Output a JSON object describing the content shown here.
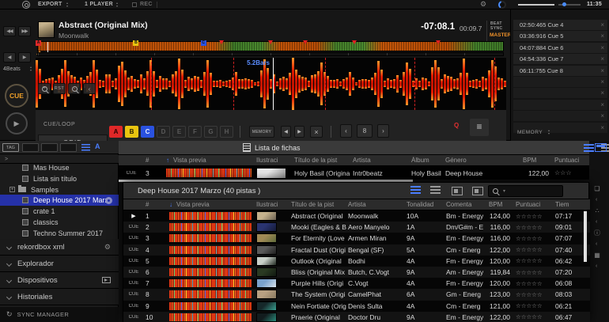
{
  "top_bar": {
    "mode": "EXPORT",
    "player": "1 PLAYER",
    "rec_label": "REC",
    "clock": "11:35",
    "accent_color": "#4a8dff"
  },
  "deck": {
    "track_title": "Abstract (Original Mix)",
    "track_artist": "Moonwalk",
    "time_remaining": "-07:08.1",
    "time_elapsed": "00:09.7",
    "beat_sync_line1": "BEAT",
    "beat_sync_line2": "SYNC",
    "master_label": "MASTER",
    "master_color": "#f0922a",
    "bars_label": "5.2Bars",
    "beat_jump_label": "4Beats",
    "cue_button_label": "CUE",
    "cue_loop_label": "CUE/LOOP",
    "grid_label": "GRID",
    "rst_label": "RST",
    "memory_label": "MEMORY",
    "memory_bank_value": "8",
    "quantize_label": "Q",
    "hot_cues": [
      {
        "label": "A",
        "bg": "#e02828",
        "fg": "#2a0000",
        "set": true
      },
      {
        "label": "B",
        "bg": "#e8c410",
        "fg": "#2a2000",
        "set": true
      },
      {
        "label": "C",
        "bg": "#2a52e0",
        "fg": "#e8eeff",
        "set": true
      },
      {
        "label": "D",
        "bg": "#242424",
        "fg": "#5a5a5a",
        "set": false
      },
      {
        "label": "E",
        "bg": "#242424",
        "fg": "#5a5a5a",
        "set": false
      },
      {
        "label": "F",
        "bg": "#242424",
        "fg": "#5a5a5a",
        "set": false
      },
      {
        "label": "G",
        "bg": "#242424",
        "fg": "#5a5a5a",
        "set": false
      },
      {
        "label": "H",
        "bg": "#242424",
        "fg": "#5a5a5a",
        "set": false
      }
    ],
    "overview_markers": [
      {
        "label": "A",
        "color": "#e02828",
        "pos": 0
      },
      {
        "label": "B",
        "color": "#e8c410",
        "pos": 21
      },
      {
        "label": "C",
        "color": "#2a52e0",
        "pos": 35.5
      },
      {
        "pos": 39.5
      },
      {
        "pos": 50
      },
      {
        "pos": 57.5
      },
      {
        "pos": 68
      },
      {
        "pos": 86
      }
    ],
    "cue_line_positions": [
      24.5,
      42,
      61.5,
      80.5,
      97.5
    ],
    "waveform_color": "#e01800"
  },
  "cue_list": {
    "items": [
      {
        "time": "02:50:465",
        "name": "Cue 4"
      },
      {
        "time": "03:36:916",
        "name": "Cue 5"
      },
      {
        "time": "04:07:884",
        "name": "Cue 6"
      },
      {
        "time": "04:54:336",
        "name": "Cue 7"
      },
      {
        "time": "06:11:755",
        "name": "Cue 8"
      }
    ],
    "empty_rows": 5,
    "memory_label": "MEMORY"
  },
  "sidebar": {
    "tag_label": "TAG",
    "collapse_caret": ">",
    "tree": [
      {
        "label": "Mas House",
        "type": "playlist"
      },
      {
        "label": "Lista sin título",
        "type": "playlist"
      },
      {
        "label": "Samples",
        "type": "folder",
        "expander": "+"
      },
      {
        "label": "Deep House 2017 Marz",
        "type": "playlist",
        "selected": true
      },
      {
        "label": "crate 1",
        "type": "playlist"
      },
      {
        "label": "classics",
        "type": "playlist"
      },
      {
        "label": "Techno Summer 2017",
        "type": "playlist"
      }
    ],
    "sections": [
      {
        "label": "rekordbox xml",
        "icon": "gear"
      },
      {
        "label": "Explorador",
        "icon": null
      },
      {
        "label": "Dispositivos",
        "icon": "device"
      },
      {
        "label": "Historiales",
        "icon": null
      }
    ],
    "sync_manager_label": "SYNC MANAGER"
  },
  "track_list": {
    "title": "Lista de fichas",
    "columns": [
      "#",
      "Vista previa",
      "Ilustraci",
      "Título de la pist",
      "Artista",
      "Álbum",
      "Género",
      "BPM",
      "Puntuaci"
    ],
    "row": {
      "marker": "CUE",
      "num": "3",
      "title": "Holy Basil (Origina",
      "artist": "Intr0beatz",
      "album": "Holy Basil",
      "genre": "Deep House",
      "bpm": "122,00",
      "rating": "☆☆☆",
      "art": [
        "#ececec",
        "#8f8f8f"
      ]
    }
  },
  "playlist_window": {
    "title": "Deep House 2017 Marzo (40 pistas )",
    "columns": [
      "#",
      "Vista previa",
      "Ilustraci",
      "Título de la pist",
      "Artista",
      "Tonalidad",
      "Comenta",
      "BPM",
      "Puntuaci",
      "Tiem"
    ],
    "rows": [
      {
        "marker": "play",
        "num": "1",
        "title": "Abstract (Original",
        "artist": "Moonwalk",
        "key": "10A",
        "comment": "Bm - Energy",
        "bpm": "124,00",
        "rating": "☆☆☆☆☆",
        "time": "07:17",
        "art": [
          "#c4b18c",
          "#6a6050"
        ]
      },
      {
        "marker": "cue",
        "num": "2",
        "title": "Mooki (Eagles & B",
        "artist": "Aero Manyelo",
        "key": "1A",
        "comment": "Dm/G#m - E",
        "bpm": "116,00",
        "rating": "☆☆☆☆☆",
        "time": "09:01",
        "art": [
          "#2a3470",
          "#141a38"
        ]
      },
      {
        "marker": "cue",
        "num": "3",
        "title": "For Eternity (Love",
        "artist": "Armen Miran",
        "key": "9A",
        "comment": "Em - Energy",
        "bpm": "116,00",
        "rating": "☆☆☆☆☆",
        "time": "07:07",
        "art": [
          "#a08a55",
          "#5f6a3a"
        ]
      },
      {
        "marker": "cue",
        "num": "4",
        "title": "Fractal Dust (Origi",
        "artist": "Bengal (SF)",
        "key": "5A",
        "comment": "Cm - Energ",
        "bpm": "122,00",
        "rating": "☆☆☆☆☆",
        "time": "07:40",
        "art": [
          "#5a5a5a",
          "#1e1e1e"
        ]
      },
      {
        "marker": "cue",
        "num": "5",
        "title": "Outlook (Original",
        "artist": "Bodhi",
        "key": "4A",
        "comment": "Fm - Energy",
        "bpm": "120,00",
        "rating": "☆☆☆☆☆",
        "time": "06:42",
        "art": [
          "#c8d0c8",
          "#222a22"
        ]
      },
      {
        "marker": "cue",
        "num": "6",
        "title": "Bliss (Original Mix",
        "artist": "Butch, C.Vogt",
        "key": "9A",
        "comment": "Am - Energy",
        "bpm": "119,84",
        "rating": "☆☆☆☆☆",
        "time": "07:20",
        "art": [
          "#2a3a22",
          "#101810"
        ]
      },
      {
        "marker": "cue",
        "num": "7",
        "title": "Purple Hills (Origi",
        "artist": "C.Vogt",
        "key": "4A",
        "comment": "Fm - Energy",
        "bpm": "120,00",
        "rating": "☆☆☆☆☆",
        "time": "06:08",
        "art": [
          "#7aa2cc",
          "#d8e2ea"
        ]
      },
      {
        "marker": "cue",
        "num": "8",
        "title": "The System (Origi",
        "artist": "CamelPhat",
        "key": "6A",
        "comment": "Gm - Energ",
        "bpm": "123,00",
        "rating": "☆☆☆☆☆",
        "time": "08:03",
        "art": [
          "#b8a082",
          "#8a7a60"
        ]
      },
      {
        "marker": "cue",
        "num": "9",
        "title": "Nein Fortiate (Orig",
        "artist": "Denis Sulta",
        "key": "4A",
        "comment": "Cm - Energ",
        "bpm": "121,00",
        "rating": "☆☆☆☆☆",
        "time": "06:21",
        "art": [
          "#16282a",
          "#3aa090"
        ]
      },
      {
        "marker": "cue",
        "num": "10",
        "title": "Praerie (Original",
        "artist": "Doctor Dru",
        "key": "9A",
        "comment": "Em - Energy",
        "bpm": "122,00",
        "rating": "☆☆☆☆☆",
        "time": "06:47",
        "art": [
          "#121c1e",
          "#2a8a7a"
        ]
      }
    ]
  }
}
